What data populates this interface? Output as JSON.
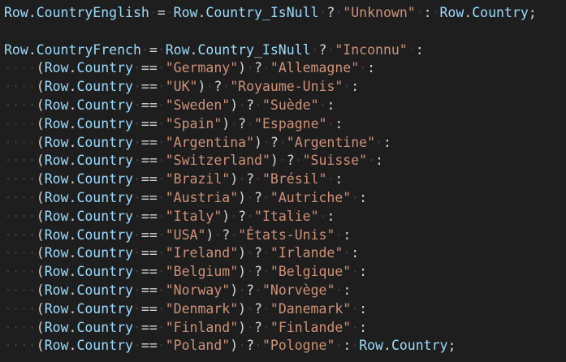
{
  "editor": {
    "colors": {
      "background": "#1e1e1e",
      "variable": "#9cdcfe",
      "string": "#ce9178",
      "operator": "#d4d4d4",
      "whitespace_marker": "#3c3c3c"
    },
    "lines": [
      [
        {
          "t": "var",
          "v": "Row"
        },
        {
          "t": "op",
          "v": "."
        },
        {
          "t": "var",
          "v": "CountryEnglish"
        },
        {
          "t": "ws",
          "v": "·"
        },
        {
          "t": "op",
          "v": "="
        },
        {
          "t": "ws",
          "v": "·"
        },
        {
          "t": "var",
          "v": "Row"
        },
        {
          "t": "op",
          "v": "."
        },
        {
          "t": "var",
          "v": "Country_IsNull"
        },
        {
          "t": "ws",
          "v": "·"
        },
        {
          "t": "op",
          "v": "?"
        },
        {
          "t": "ws",
          "v": "·"
        },
        {
          "t": "str",
          "v": "\"Unknown\""
        },
        {
          "t": "ws",
          "v": "·"
        },
        {
          "t": "op",
          "v": ":"
        },
        {
          "t": "ws",
          "v": "·"
        },
        {
          "t": "var",
          "v": "Row"
        },
        {
          "t": "op",
          "v": "."
        },
        {
          "t": "var",
          "v": "Country"
        },
        {
          "t": "op",
          "v": ";"
        }
      ],
      [],
      [
        {
          "t": "var",
          "v": "Row"
        },
        {
          "t": "op",
          "v": "."
        },
        {
          "t": "var",
          "v": "CountryFrench"
        },
        {
          "t": "ws",
          "v": "·"
        },
        {
          "t": "op",
          "v": "="
        },
        {
          "t": "ws",
          "v": "·"
        },
        {
          "t": "var",
          "v": "Row"
        },
        {
          "t": "op",
          "v": "."
        },
        {
          "t": "var",
          "v": "Country_IsNull"
        },
        {
          "t": "ws",
          "v": "·"
        },
        {
          "t": "op",
          "v": "?"
        },
        {
          "t": "ws",
          "v": "·"
        },
        {
          "t": "str",
          "v": "\"Inconnu\""
        },
        {
          "t": "ws",
          "v": "·"
        },
        {
          "t": "op",
          "v": ":"
        }
      ],
      [
        {
          "t": "ws",
          "v": "····"
        },
        {
          "t": "op",
          "v": "("
        },
        {
          "t": "var",
          "v": "Row"
        },
        {
          "t": "op",
          "v": "."
        },
        {
          "t": "var",
          "v": "Country"
        },
        {
          "t": "ws",
          "v": "·"
        },
        {
          "t": "op",
          "v": "=="
        },
        {
          "t": "ws",
          "v": "·"
        },
        {
          "t": "str",
          "v": "\"Germany\""
        },
        {
          "t": "op",
          "v": ")"
        },
        {
          "t": "ws",
          "v": "·"
        },
        {
          "t": "op",
          "v": "?"
        },
        {
          "t": "ws",
          "v": "·"
        },
        {
          "t": "str",
          "v": "\"Allemagne\""
        },
        {
          "t": "ws",
          "v": "·"
        },
        {
          "t": "op",
          "v": ":"
        }
      ],
      [
        {
          "t": "ws",
          "v": "····"
        },
        {
          "t": "op",
          "v": "("
        },
        {
          "t": "var",
          "v": "Row"
        },
        {
          "t": "op",
          "v": "."
        },
        {
          "t": "var",
          "v": "Country"
        },
        {
          "t": "ws",
          "v": "·"
        },
        {
          "t": "op",
          "v": "=="
        },
        {
          "t": "ws",
          "v": "·"
        },
        {
          "t": "str",
          "v": "\"UK\""
        },
        {
          "t": "op",
          "v": ")"
        },
        {
          "t": "ws",
          "v": "·"
        },
        {
          "t": "op",
          "v": "?"
        },
        {
          "t": "ws",
          "v": "·"
        },
        {
          "t": "str",
          "v": "\"Royaume-Unis\""
        },
        {
          "t": "ws",
          "v": "·"
        },
        {
          "t": "op",
          "v": ":"
        }
      ],
      [
        {
          "t": "ws",
          "v": "····"
        },
        {
          "t": "op",
          "v": "("
        },
        {
          "t": "var",
          "v": "Row"
        },
        {
          "t": "op",
          "v": "."
        },
        {
          "t": "var",
          "v": "Country"
        },
        {
          "t": "ws",
          "v": "·"
        },
        {
          "t": "op",
          "v": "=="
        },
        {
          "t": "ws",
          "v": "·"
        },
        {
          "t": "str",
          "v": "\"Sweden\""
        },
        {
          "t": "op",
          "v": ")"
        },
        {
          "t": "ws",
          "v": "·"
        },
        {
          "t": "op",
          "v": "?"
        },
        {
          "t": "ws",
          "v": "·"
        },
        {
          "t": "str",
          "v": "\"Suède\""
        },
        {
          "t": "ws",
          "v": "·"
        },
        {
          "t": "op",
          "v": ":"
        }
      ],
      [
        {
          "t": "ws",
          "v": "····"
        },
        {
          "t": "op",
          "v": "("
        },
        {
          "t": "var",
          "v": "Row"
        },
        {
          "t": "op",
          "v": "."
        },
        {
          "t": "var",
          "v": "Country"
        },
        {
          "t": "ws",
          "v": "·"
        },
        {
          "t": "op",
          "v": "=="
        },
        {
          "t": "ws",
          "v": "·"
        },
        {
          "t": "str",
          "v": "\"Spain\""
        },
        {
          "t": "op",
          "v": ")"
        },
        {
          "t": "ws",
          "v": "·"
        },
        {
          "t": "op",
          "v": "?"
        },
        {
          "t": "ws",
          "v": "·"
        },
        {
          "t": "str",
          "v": "\"Espagne\""
        },
        {
          "t": "ws",
          "v": "·"
        },
        {
          "t": "op",
          "v": ":"
        }
      ],
      [
        {
          "t": "ws",
          "v": "····"
        },
        {
          "t": "op",
          "v": "("
        },
        {
          "t": "var",
          "v": "Row"
        },
        {
          "t": "op",
          "v": "."
        },
        {
          "t": "var",
          "v": "Country"
        },
        {
          "t": "ws",
          "v": "·"
        },
        {
          "t": "op",
          "v": "=="
        },
        {
          "t": "ws",
          "v": "·"
        },
        {
          "t": "str",
          "v": "\"Argentina\""
        },
        {
          "t": "op",
          "v": ")"
        },
        {
          "t": "ws",
          "v": "·"
        },
        {
          "t": "op",
          "v": "?"
        },
        {
          "t": "ws",
          "v": "·"
        },
        {
          "t": "str",
          "v": "\"Argentine\""
        },
        {
          "t": "ws",
          "v": "·"
        },
        {
          "t": "op",
          "v": ":"
        }
      ],
      [
        {
          "t": "ws",
          "v": "····"
        },
        {
          "t": "op",
          "v": "("
        },
        {
          "t": "var",
          "v": "Row"
        },
        {
          "t": "op",
          "v": "."
        },
        {
          "t": "var",
          "v": "Country"
        },
        {
          "t": "ws",
          "v": "·"
        },
        {
          "t": "op",
          "v": "=="
        },
        {
          "t": "ws",
          "v": "·"
        },
        {
          "t": "str",
          "v": "\"Switzerland\""
        },
        {
          "t": "op",
          "v": ")"
        },
        {
          "t": "ws",
          "v": "·"
        },
        {
          "t": "op",
          "v": "?"
        },
        {
          "t": "ws",
          "v": "·"
        },
        {
          "t": "str",
          "v": "\"Suisse\""
        },
        {
          "t": "ws",
          "v": "·"
        },
        {
          "t": "op",
          "v": ":"
        }
      ],
      [
        {
          "t": "ws",
          "v": "····"
        },
        {
          "t": "op",
          "v": "("
        },
        {
          "t": "var",
          "v": "Row"
        },
        {
          "t": "op",
          "v": "."
        },
        {
          "t": "var",
          "v": "Country"
        },
        {
          "t": "ws",
          "v": "·"
        },
        {
          "t": "op",
          "v": "=="
        },
        {
          "t": "ws",
          "v": "·"
        },
        {
          "t": "str",
          "v": "\"Brazil\""
        },
        {
          "t": "op",
          "v": ")"
        },
        {
          "t": "ws",
          "v": "·"
        },
        {
          "t": "op",
          "v": "?"
        },
        {
          "t": "ws",
          "v": "·"
        },
        {
          "t": "str",
          "v": "\"Brésil\""
        },
        {
          "t": "ws",
          "v": "·"
        },
        {
          "t": "op",
          "v": ":"
        }
      ],
      [
        {
          "t": "ws",
          "v": "····"
        },
        {
          "t": "op",
          "v": "("
        },
        {
          "t": "var",
          "v": "Row"
        },
        {
          "t": "op",
          "v": "."
        },
        {
          "t": "var",
          "v": "Country"
        },
        {
          "t": "ws",
          "v": "·"
        },
        {
          "t": "op",
          "v": "=="
        },
        {
          "t": "ws",
          "v": "·"
        },
        {
          "t": "str",
          "v": "\"Austria\""
        },
        {
          "t": "op",
          "v": ")"
        },
        {
          "t": "ws",
          "v": "·"
        },
        {
          "t": "op",
          "v": "?"
        },
        {
          "t": "ws",
          "v": "·"
        },
        {
          "t": "str",
          "v": "\"Autriche\""
        },
        {
          "t": "ws",
          "v": "·"
        },
        {
          "t": "op",
          "v": ":"
        }
      ],
      [
        {
          "t": "ws",
          "v": "····"
        },
        {
          "t": "op",
          "v": "("
        },
        {
          "t": "var",
          "v": "Row"
        },
        {
          "t": "op",
          "v": "."
        },
        {
          "t": "var",
          "v": "Country"
        },
        {
          "t": "ws",
          "v": "·"
        },
        {
          "t": "op",
          "v": "=="
        },
        {
          "t": "ws",
          "v": "·"
        },
        {
          "t": "str",
          "v": "\"Italy\""
        },
        {
          "t": "op",
          "v": ")"
        },
        {
          "t": "ws",
          "v": "·"
        },
        {
          "t": "op",
          "v": "?"
        },
        {
          "t": "ws",
          "v": "·"
        },
        {
          "t": "str",
          "v": "\"Italie\""
        },
        {
          "t": "ws",
          "v": "·"
        },
        {
          "t": "op",
          "v": ":"
        }
      ],
      [
        {
          "t": "ws",
          "v": "····"
        },
        {
          "t": "op",
          "v": "("
        },
        {
          "t": "var",
          "v": "Row"
        },
        {
          "t": "op",
          "v": "."
        },
        {
          "t": "var",
          "v": "Country"
        },
        {
          "t": "ws",
          "v": "·"
        },
        {
          "t": "op",
          "v": "=="
        },
        {
          "t": "ws",
          "v": "·"
        },
        {
          "t": "str",
          "v": "\"USA\""
        },
        {
          "t": "op",
          "v": ")"
        },
        {
          "t": "ws",
          "v": "·"
        },
        {
          "t": "op",
          "v": "?"
        },
        {
          "t": "ws",
          "v": "·"
        },
        {
          "t": "str",
          "v": "\"États-Unis\""
        },
        {
          "t": "ws",
          "v": "·"
        },
        {
          "t": "op",
          "v": ":"
        }
      ],
      [
        {
          "t": "ws",
          "v": "····"
        },
        {
          "t": "op",
          "v": "("
        },
        {
          "t": "var",
          "v": "Row"
        },
        {
          "t": "op",
          "v": "."
        },
        {
          "t": "var",
          "v": "Country"
        },
        {
          "t": "ws",
          "v": "·"
        },
        {
          "t": "op",
          "v": "=="
        },
        {
          "t": "ws",
          "v": "·"
        },
        {
          "t": "str",
          "v": "\"Ireland\""
        },
        {
          "t": "op",
          "v": ")"
        },
        {
          "t": "ws",
          "v": "·"
        },
        {
          "t": "op",
          "v": "?"
        },
        {
          "t": "ws",
          "v": "·"
        },
        {
          "t": "str",
          "v": "\"Irlande\""
        },
        {
          "t": "ws",
          "v": "·"
        },
        {
          "t": "op",
          "v": ":"
        }
      ],
      [
        {
          "t": "ws",
          "v": "····"
        },
        {
          "t": "op",
          "v": "("
        },
        {
          "t": "var",
          "v": "Row"
        },
        {
          "t": "op",
          "v": "."
        },
        {
          "t": "var",
          "v": "Country"
        },
        {
          "t": "ws",
          "v": "·"
        },
        {
          "t": "op",
          "v": "=="
        },
        {
          "t": "ws",
          "v": "·"
        },
        {
          "t": "str",
          "v": "\"Belgium\""
        },
        {
          "t": "op",
          "v": ")"
        },
        {
          "t": "ws",
          "v": "·"
        },
        {
          "t": "op",
          "v": "?"
        },
        {
          "t": "ws",
          "v": "·"
        },
        {
          "t": "str",
          "v": "\"Belgique\""
        },
        {
          "t": "ws",
          "v": "·"
        },
        {
          "t": "op",
          "v": ":"
        }
      ],
      [
        {
          "t": "ws",
          "v": "····"
        },
        {
          "t": "op",
          "v": "("
        },
        {
          "t": "var",
          "v": "Row"
        },
        {
          "t": "op",
          "v": "."
        },
        {
          "t": "var",
          "v": "Country"
        },
        {
          "t": "ws",
          "v": "·"
        },
        {
          "t": "op",
          "v": "=="
        },
        {
          "t": "ws",
          "v": "·"
        },
        {
          "t": "str",
          "v": "\"Norway\""
        },
        {
          "t": "op",
          "v": ")"
        },
        {
          "t": "ws",
          "v": "·"
        },
        {
          "t": "op",
          "v": "?"
        },
        {
          "t": "ws",
          "v": "·"
        },
        {
          "t": "str",
          "v": "\"Norvège\""
        },
        {
          "t": "ws",
          "v": "·"
        },
        {
          "t": "op",
          "v": ":"
        }
      ],
      [
        {
          "t": "ws",
          "v": "····"
        },
        {
          "t": "op",
          "v": "("
        },
        {
          "t": "var",
          "v": "Row"
        },
        {
          "t": "op",
          "v": "."
        },
        {
          "t": "var",
          "v": "Country"
        },
        {
          "t": "ws",
          "v": "·"
        },
        {
          "t": "op",
          "v": "=="
        },
        {
          "t": "ws",
          "v": "·"
        },
        {
          "t": "str",
          "v": "\"Denmark\""
        },
        {
          "t": "op",
          "v": ")"
        },
        {
          "t": "ws",
          "v": "·"
        },
        {
          "t": "op",
          "v": "?"
        },
        {
          "t": "ws",
          "v": "·"
        },
        {
          "t": "str",
          "v": "\"Danemark\""
        },
        {
          "t": "ws",
          "v": "·"
        },
        {
          "t": "op",
          "v": ":"
        }
      ],
      [
        {
          "t": "ws",
          "v": "····"
        },
        {
          "t": "op",
          "v": "("
        },
        {
          "t": "var",
          "v": "Row"
        },
        {
          "t": "op",
          "v": "."
        },
        {
          "t": "var",
          "v": "Country"
        },
        {
          "t": "ws",
          "v": "·"
        },
        {
          "t": "op",
          "v": "=="
        },
        {
          "t": "ws",
          "v": "·"
        },
        {
          "t": "str",
          "v": "\"Finland\""
        },
        {
          "t": "op",
          "v": ")"
        },
        {
          "t": "ws",
          "v": "·"
        },
        {
          "t": "op",
          "v": "?"
        },
        {
          "t": "ws",
          "v": "·"
        },
        {
          "t": "str",
          "v": "\"Finlande\""
        },
        {
          "t": "ws",
          "v": "·"
        },
        {
          "t": "op",
          "v": ":"
        }
      ],
      [
        {
          "t": "ws",
          "v": "····"
        },
        {
          "t": "op",
          "v": "("
        },
        {
          "t": "var",
          "v": "Row"
        },
        {
          "t": "op",
          "v": "."
        },
        {
          "t": "var",
          "v": "Country"
        },
        {
          "t": "ws",
          "v": "·"
        },
        {
          "t": "op",
          "v": "=="
        },
        {
          "t": "ws",
          "v": "·"
        },
        {
          "t": "str",
          "v": "\"Poland\""
        },
        {
          "t": "op",
          "v": ")"
        },
        {
          "t": "ws",
          "v": "·"
        },
        {
          "t": "op",
          "v": "?"
        },
        {
          "t": "ws",
          "v": "·"
        },
        {
          "t": "str",
          "v": "\"Pologne\""
        },
        {
          "t": "ws",
          "v": "·"
        },
        {
          "t": "op",
          "v": ":"
        },
        {
          "t": "ws",
          "v": "·"
        },
        {
          "t": "var",
          "v": "Row"
        },
        {
          "t": "op",
          "v": "."
        },
        {
          "t": "var",
          "v": "Country"
        },
        {
          "t": "op",
          "v": ";"
        }
      ]
    ]
  }
}
